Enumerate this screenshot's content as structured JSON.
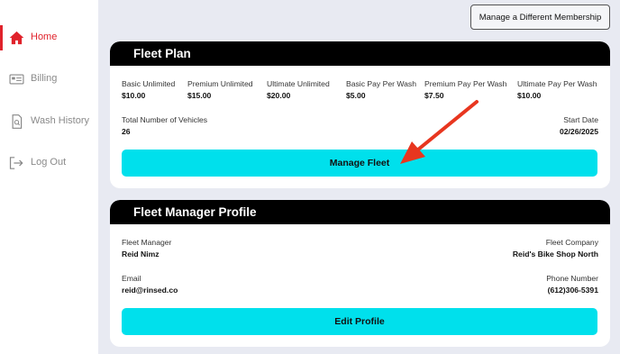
{
  "sidebar": {
    "items": [
      {
        "label": "Home",
        "icon": "home-icon",
        "active": true
      },
      {
        "label": "Billing",
        "icon": "billing-icon"
      },
      {
        "label": "Wash History",
        "icon": "wash-history-icon"
      },
      {
        "label": "Log Out",
        "icon": "logout-icon"
      }
    ]
  },
  "header": {
    "manage_membership_label": "Manage a Different Membership"
  },
  "fleet_plan": {
    "title": "Fleet Plan",
    "plans": [
      {
        "name": "Basic Unlimited",
        "price": "$10.00"
      },
      {
        "name": "Premium Unlimited",
        "price": "$15.00"
      },
      {
        "name": "Ultimate Unlimited",
        "price": "$20.00"
      },
      {
        "name": "Basic Pay Per Wash",
        "price": "$5.00"
      },
      {
        "name": "Premium Pay Per Wash",
        "price": "$7.50"
      },
      {
        "name": "Ultimate Pay Per Wash",
        "price": "$10.00"
      }
    ],
    "vehicles_label": "Total Number of Vehicles",
    "vehicles_value": "26",
    "start_date_label": "Start Date",
    "start_date_value": "02/26/2025",
    "manage_button": "Manage Fleet"
  },
  "profile": {
    "title": "Fleet Manager Profile",
    "manager_label": "Fleet Manager",
    "manager_value": "Reid Nimz",
    "company_label": "Fleet Company",
    "company_value": "Reid's Bike Shop North",
    "email_label": "Email",
    "email_value": "reid@rinsed.co",
    "phone_label": "Phone Number",
    "phone_value": "(612)306-5391",
    "edit_button": "Edit Profile"
  },
  "colors": {
    "accent": "#e0222b",
    "button": "#00e0ec",
    "arrow": "#e8361f",
    "background": "#e8eaf2"
  }
}
